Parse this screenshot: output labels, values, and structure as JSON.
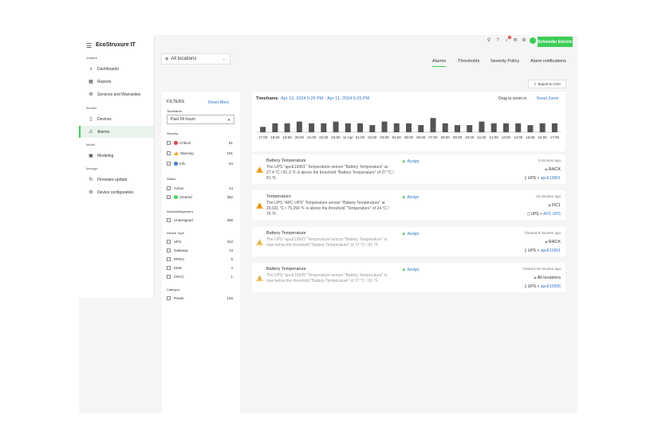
{
  "app": {
    "title": "EcoStruxure IT"
  },
  "topbar": {
    "notification_count": "1",
    "brand": "Schneider Electric"
  },
  "sidebar": {
    "sections": [
      {
        "label": "Analyze",
        "items": [
          {
            "label": "Dashboards",
            "icon": "dashboard-icon"
          },
          {
            "label": "Reports",
            "icon": "report-icon"
          },
          {
            "label": "Services and Warranties",
            "icon": "services-icon"
          }
        ]
      },
      {
        "label": "Monitor",
        "items": [
          {
            "label": "Devices",
            "icon": "devices-icon"
          },
          {
            "label": "Alarms",
            "icon": "alarm-icon"
          }
        ]
      },
      {
        "label": "Model",
        "items": [
          {
            "label": "Modeling",
            "icon": "modeling-icon"
          }
        ]
      },
      {
        "label": "Manage",
        "items": [
          {
            "label": "Firmware update",
            "icon": "firmware-icon"
          },
          {
            "label": "Device configuration",
            "icon": "config-icon"
          }
        ]
      }
    ]
  },
  "location": {
    "value": "All locations"
  },
  "tabs": [
    {
      "label": "Alarms"
    },
    {
      "label": "Thresholds"
    },
    {
      "label": "Severity Policy"
    },
    {
      "label": "Alarm notifications"
    }
  ],
  "export_label": "Export to CSV",
  "filters": {
    "title": "FILTERS",
    "reset": "Reset filters",
    "timeframe_label": "Timeframe",
    "timeframe_value": "Past 24 hours",
    "severity_label": "Severity",
    "severity": [
      {
        "label": "Critical",
        "count": "81"
      },
      {
        "label": "Warning",
        "count": "191"
      },
      {
        "label": "Info",
        "count": "94"
      }
    ],
    "status_label": "Status",
    "status": [
      {
        "label": "Active",
        "count": "14"
      },
      {
        "label": "Cleared",
        "count": "352"
      }
    ],
    "ack_label": "Acknowledgement",
    "ack": [
      {
        "label": "Unassigned",
        "count": "366"
      }
    ],
    "device_type_label": "Device Type",
    "device_types": [
      {
        "label": "UPS",
        "count": "342"
      },
      {
        "label": "Gateway",
        "count": "14"
      },
      {
        "label": "RPDU",
        "count": "5"
      },
      {
        "label": "EMS",
        "count": "4"
      },
      {
        "label": "CRAC",
        "count": "1"
      }
    ],
    "category_label": "Category",
    "category": [
      {
        "label": "Power",
        "count": "146"
      }
    ]
  },
  "timeframe": {
    "label": "Timeframe",
    "range": "Apr 10, 2024 5:25 PM  -  Apr 11, 2024 5:25 PM",
    "drag_hint": "Drag to zoom in",
    "reset_zoom": "Reset Zoom"
  },
  "chart_data": {
    "type": "bar",
    "categories": [
      "17:00",
      "18:00",
      "19:00",
      "20:00",
      "21:00",
      "22:00",
      "23:00",
      "11 Apr",
      "01:00",
      "02:00",
      "03:00",
      "04:00",
      "05:00",
      "06:00",
      "07:00",
      "08:00",
      "09:00",
      "10:00",
      "11:00",
      "12:00",
      "13:00",
      "14:00",
      "15:00",
      "16:00",
      "17:00"
    ],
    "values": [
      3,
      5,
      5,
      6,
      5,
      5,
      6,
      5,
      5,
      4,
      6,
      5,
      5,
      4,
      8,
      5,
      4,
      4,
      6,
      5,
      5,
      5,
      4,
      5,
      5
    ],
    "title": "",
    "xlabel": "",
    "ylabel": ""
  },
  "alarms": [
    {
      "title": "Battery Temperature",
      "desc": "The UPS \"apcE19901\" Temperature sensor \"Battery Temperature\" at 27.4 °C / 81.3 °F is above the threshold \"Battery Temperature\" of 27 °C / 81 °F.",
      "assign": "Assign",
      "time": "3 minutes ago",
      "location": "RACK",
      "device_type": "UPS",
      "device": "apcE19901",
      "state": "active"
    },
    {
      "title": "Temperature",
      "desc": "The UPS \"APC UPS\" Temperature sensor \"Battery Temperature\" at 24.031 °C / 75.256 °F is above the threshold \"Temperature\" of 24 °C / 75 °F.",
      "assign": "Assign",
      "time": "26 minutes ago",
      "location": "DC1",
      "device_type": "UPS",
      "device": "APC UPS",
      "state": "active"
    },
    {
      "title": "Battery Temperature",
      "desc": "The UPS \"apcE19901\" Temperature sensor \"Battery Temperature\" is now below the threshold \"Battery Temperature\" of 27 °C / 81 °F.",
      "assign": "Assign",
      "time": "Cleared 8 minutes ago",
      "location": "RACK",
      "device_type": "UPS",
      "device": "apcE19901",
      "state": "cleared"
    },
    {
      "title": "Battery Temperature",
      "desc": "The UPS \"apcE19905\" Temperature sensor \"Battery Temperature\" is now below the threshold \"Battery Temperature\" of 27 °C / 81 °F.",
      "assign": "Assign",
      "time": "Cleared 10 minutes ago",
      "location": "All locations",
      "device_type": "UPS",
      "device": "apcE19905",
      "state": "cleared"
    }
  ]
}
